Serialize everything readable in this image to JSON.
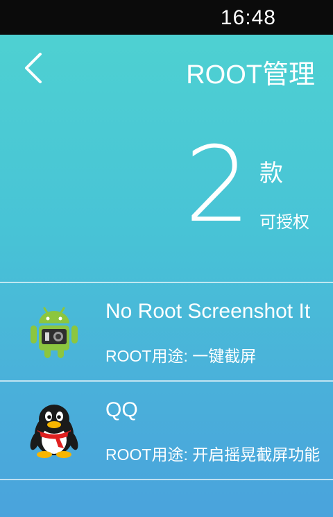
{
  "status": {
    "time": "16:48"
  },
  "header": {
    "title": "ROOT管理",
    "back_icon": "chevron-left-icon"
  },
  "summary": {
    "count": "2",
    "unit": "款",
    "label": "可授权"
  },
  "apps": [
    {
      "name": "No Root Screenshot It",
      "purpose": "ROOT用途: 一键截屏",
      "icon": "android-camera-icon"
    },
    {
      "name": "QQ",
      "purpose": "ROOT用途: 开启摇晃截屏功能",
      "icon": "qq-penguin-icon"
    }
  ],
  "colors": {
    "top": "#4fd3d1",
    "bottom": "#4aa3dc",
    "statusbar": "#0b0b0b"
  }
}
